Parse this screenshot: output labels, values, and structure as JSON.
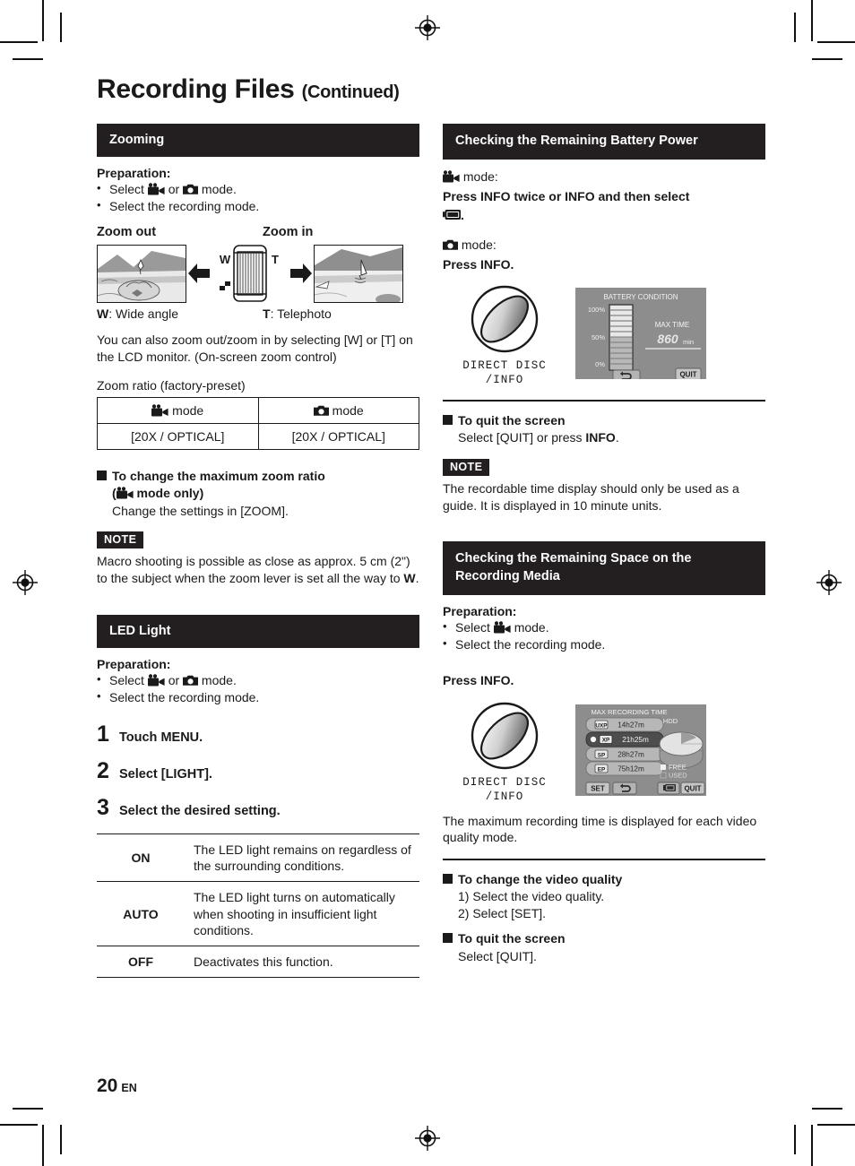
{
  "page": {
    "title": "Recording Files",
    "title_suffix": "(Continued)",
    "number": "20",
    "lang": "EN"
  },
  "left_column": {
    "zooming": {
      "heading": "Zooming",
      "prep_title": "Preparation:",
      "prep_1_pre": "Select ",
      "prep_1_mid": " or ",
      "prep_1_post": " mode.",
      "prep_2": "Select the recording mode.",
      "zoom_out_label": "Zoom out",
      "zoom_in_label": "Zoom in",
      "lever_w": "W",
      "lever_t": "T",
      "caption_w_key": "W",
      "caption_w": ": Wide angle",
      "caption_t_key": "T",
      "caption_t": ": Telephoto",
      "body": "You can also zoom out/zoom in by selecting [W] or [T] on the LCD monitor. (On-screen zoom control)",
      "ratio_title": "Zoom ratio (factory-preset)",
      "ratio_table": {
        "headers": [
          "mode",
          "mode"
        ],
        "header_icons": [
          "video-mode-icon",
          "photo-mode-icon"
        ],
        "values": [
          "[20X / OPTICAL]",
          "[20X / OPTICAL]"
        ]
      },
      "change_max_heading_1": "To change the maximum zoom ratio",
      "change_max_heading_2_pre": "(",
      "change_max_heading_2_post": " mode only)",
      "change_max_body": "Change the settings in [ZOOM].",
      "note_tag": "NOTE",
      "note_body": "Macro shooting is possible as close as approx. 5 cm (2\") to the subject when the zoom lever is set all the way to ",
      "note_body_bold": "W",
      "note_body_end": "."
    },
    "led_light": {
      "heading": "LED Light",
      "prep_title": "Preparation:",
      "prep_1_pre": "Select ",
      "prep_1_mid": " or ",
      "prep_1_post": " mode.",
      "prep_2": "Select the recording mode.",
      "steps": [
        {
          "n": "1",
          "text": "Touch MENU."
        },
        {
          "n": "2",
          "text": "Select [LIGHT]."
        },
        {
          "n": "3",
          "text": "Select the desired setting."
        }
      ],
      "settings": [
        {
          "key": "ON",
          "desc": "The LED light remains on regardless of the surrounding conditions."
        },
        {
          "key": "AUTO",
          "desc": "The LED light turns on automatically when shooting in insufficient light conditions."
        },
        {
          "key": "OFF",
          "desc": "Deactivates this function."
        }
      ]
    }
  },
  "right_column": {
    "battery": {
      "heading": "Checking the Remaining Battery Power",
      "video_mode_label": "mode:",
      "video_instruction": "Press INFO twice or INFO and then select",
      "video_instruction_end": ".",
      "photo_mode_label": "mode:",
      "photo_instruction": "Press INFO.",
      "info_button_caption_1": "DIRECT DISC",
      "info_button_caption_2": "/INFO",
      "lcd": {
        "title": "BATTERY CONDITION",
        "scale": [
          "100%",
          "50%",
          "0%"
        ],
        "max_time_label": "MAX TIME",
        "max_time_value": "860",
        "max_time_unit": "min",
        "quit_label": "QUIT",
        "back_icon": "back-arrow-icon"
      },
      "quit_heading": "To quit the screen",
      "quit_body_pre": "Select [QUIT] or press ",
      "quit_body_bold": "INFO",
      "quit_body_post": ".",
      "note_tag": "NOTE",
      "note_body": "The recordable time display should only be used as a guide. It is displayed in 10 minute units."
    },
    "media": {
      "heading": "Checking the Remaining Space on the Recording Media",
      "prep_title": "Preparation:",
      "prep_1_pre": "Select ",
      "prep_1_post": " mode.",
      "prep_2": "Select the recording mode.",
      "press_info": "Press INFO.",
      "info_button_caption_1": "DIRECT DISC",
      "info_button_caption_2": "/INFO",
      "lcd": {
        "title": "MAX RECORDING TIME",
        "hdd_label": "HDD",
        "rows": [
          {
            "quality": "UXP",
            "time": "14h27m",
            "selected": false
          },
          {
            "quality": "XP",
            "time": "21h25m",
            "selected": true
          },
          {
            "quality": "SP",
            "time": "28h27m",
            "selected": false
          },
          {
            "quality": "EP",
            "time": "75h12m",
            "selected": false
          }
        ],
        "legend": [
          {
            "label": "FREE",
            "color": "#f2f2f2"
          },
          {
            "label": "USED",
            "color": "#8a8a8a"
          }
        ],
        "set_label": "SET",
        "quit_label": "QUIT",
        "back_icon": "back-arrow-icon",
        "battery_icon": "battery-icon"
      },
      "body": "The maximum recording time is displayed for each video quality mode.",
      "change_quality_heading": "To change the video quality",
      "change_quality_steps": [
        "1) Select the video quality.",
        "2) Select [SET]."
      ],
      "quit_heading": "To quit the screen",
      "quit_body": "Select [QUIT]."
    }
  }
}
